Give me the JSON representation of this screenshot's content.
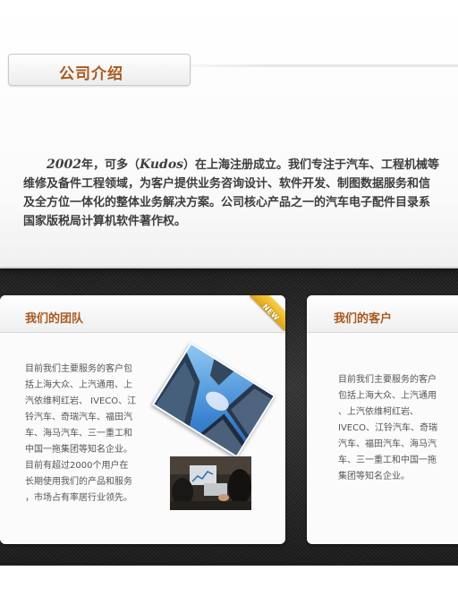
{
  "intro": {
    "title": "公司介绍",
    "paragraph_lines": [
      "维修及备件工程领域，为客户提供业务咨询设计、软件开发、制图数据服务和信",
      "及全方位一体化的整体业务解决方案。公司核心产品之一的汽车电子配件目录系",
      "国家版税局计算机软件著作权。"
    ],
    "first_line": {
      "year": "2002",
      "mid": "年，可多（",
      "brand": "Kudos",
      "rest": "）在上海注册成立。我们专注于汽车、工程机械等"
    }
  },
  "team": {
    "title": "我们的团队",
    "badge": "NEW",
    "lines": [
      "目前我们主要服务的客户包",
      "括上海大众、上汽通用、上",
      "汽依维柯红岩、 IVECO、江",
      "铃汽车、奇瑞汽车、福田汽",
      "车、海马汽车、三一重工和",
      "中国一拖集团等知名企业。",
      "目前有超过2000个用户在",
      "长期使用我们的产品和服务",
      "，市场占有率居行业领先。"
    ]
  },
  "clients": {
    "title": "我们的客户",
    "lines": [
      "目前我们主要服务的客户",
      "包括上海大众、上汽通用",
      "、上汽依维柯红岩、",
      "IVECO、江铃汽车、奇瑞",
      "汽车、福田汽车、海马汽",
      "车、三一重工和中国一拖",
      "集团等知名企业。"
    ]
  },
  "colors": {
    "accent": "#a8591e",
    "body_text": "#555555",
    "dark_band": "#2b2b2b",
    "badge": "#e6b020"
  },
  "icons": [
    "new-ribbon-badge",
    "skyscraper-photo",
    "business-meeting-photo"
  ]
}
